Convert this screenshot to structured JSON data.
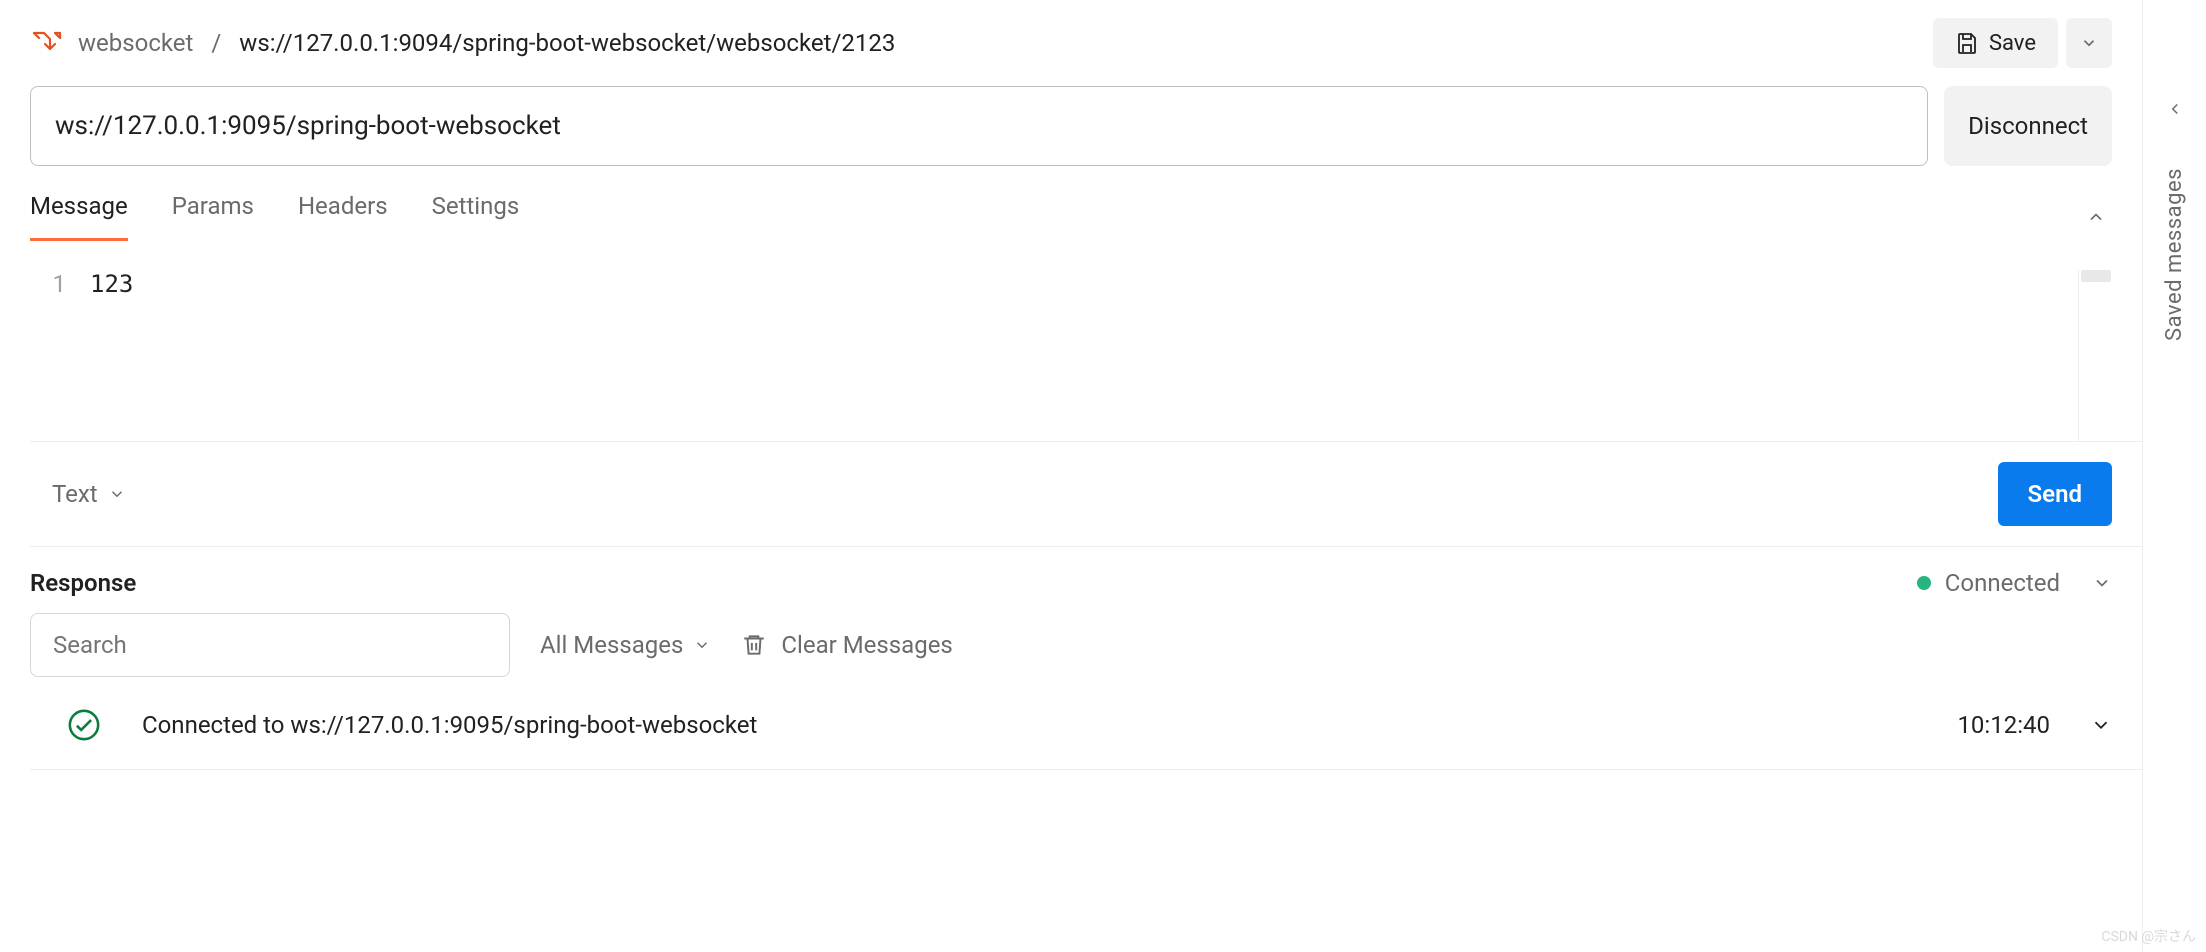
{
  "breadcrumb": {
    "workspace": "websocket",
    "separator": "/",
    "request": "ws://127.0.0.1:9094/spring-boot-websocket/websocket/2123"
  },
  "header": {
    "save_label": "Save"
  },
  "url_bar": {
    "value": "ws://127.0.0.1:9095/spring-boot-websocket",
    "disconnect_label": "Disconnect"
  },
  "tabs": {
    "items": [
      "Message",
      "Params",
      "Headers",
      "Settings"
    ],
    "active_index": 0
  },
  "editor": {
    "line_number": "1",
    "content": "123"
  },
  "composer": {
    "type_label": "Text",
    "send_label": "Send"
  },
  "response": {
    "title": "Response",
    "status_text": "Connected",
    "search_placeholder": "Search",
    "filter_label": "All Messages",
    "clear_label": "Clear Messages"
  },
  "messages": [
    {
      "text": "Connected to ws://127.0.0.1:9095/spring-boot-websocket",
      "time": "10:12:40"
    }
  ],
  "right_rail": {
    "label": "Saved messages"
  },
  "watermark": "CSDN @宗さん"
}
